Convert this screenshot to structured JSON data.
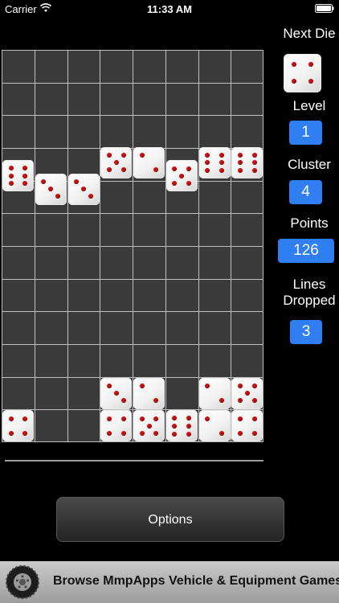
{
  "status_bar": {
    "carrier": "Carrier",
    "time": "11:33 AM"
  },
  "panel": {
    "next_die_label": "Next Die",
    "next_die_value": 4,
    "level_label": "Level",
    "level_value": "1",
    "cluster_label": "Cluster",
    "cluster_value": "4",
    "points_label": "Points",
    "points_value": "126",
    "lines_dropped_label_line1": "Lines",
    "lines_dropped_label_line2": "Dropped",
    "lines_dropped_value": "3"
  },
  "board": {
    "columns": 8,
    "rows": 12,
    "dice": [
      {
        "col": 0,
        "value": 6,
        "offset": 3.35
      },
      {
        "col": 1,
        "value": 3,
        "offset": 3.75
      },
      {
        "col": 2,
        "value": 3,
        "offset": 3.75
      },
      {
        "col": 3,
        "value": 5,
        "offset": 2.95
      },
      {
        "col": 4,
        "value": 2,
        "offset": 2.95
      },
      {
        "col": 5,
        "value": 5,
        "offset": 3.35
      },
      {
        "col": 6,
        "value": 6,
        "offset": 2.95
      },
      {
        "col": 7,
        "value": 6,
        "offset": 2.95
      },
      {
        "col": 3,
        "value": 3,
        "offset": 10.0
      },
      {
        "col": 4,
        "value": 2,
        "offset": 10.0
      },
      {
        "col": 6,
        "value": 2,
        "offset": 10.0
      },
      {
        "col": 7,
        "value": 5,
        "offset": 10.0
      },
      {
        "col": 0,
        "value": 4,
        "offset": 11.0
      },
      {
        "col": 3,
        "value": 4,
        "offset": 11.0
      },
      {
        "col": 4,
        "value": 5,
        "offset": 11.0
      },
      {
        "col": 5,
        "value": 6,
        "offset": 11.0
      },
      {
        "col": 6,
        "value": 2,
        "offset": 11.0
      },
      {
        "col": 7,
        "value": 4,
        "offset": 11.0
      }
    ]
  },
  "options_button_label": "Options",
  "ad_banner": {
    "text": "Browse MmpApps Vehicle & Equipment Games",
    "icon": "tire-icon"
  },
  "colors": {
    "value_box": "#2f7ff3",
    "pip": "#cc1010",
    "board_bg": "#3a3a3a",
    "grid": "#bfbfbf"
  }
}
